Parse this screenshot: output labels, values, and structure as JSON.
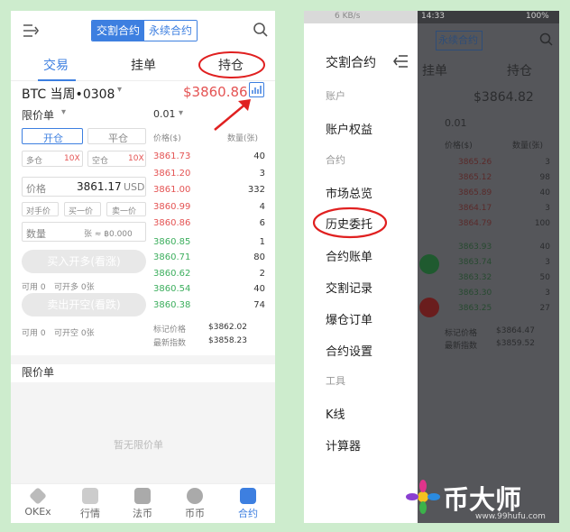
{
  "left": {
    "seg": [
      "交割合约",
      "永续合约"
    ],
    "tabs": [
      "交易",
      "挂单",
      "持仓"
    ],
    "symbol": "BTC 当周•0308",
    "price": "$3860.86",
    "order_type": "限价单",
    "qty_step": "0.01",
    "open_btn": "开仓",
    "close_btn": "平仓",
    "lev_long": "多仓",
    "lev_long_val": "10X",
    "lev_short": "空仓",
    "lev_short_val": "10X",
    "price_label": "价格",
    "price_value": "3861.17",
    "price_unit": "USD",
    "quick": [
      "对手价",
      "买一价",
      "卖一价"
    ],
    "qty_label": "数量",
    "qty_suffix": "张 ≈ ฿0.000",
    "buy_btn": "买入开多(看涨)",
    "avail1": "可用 0",
    "avail1b": "可开多 0张",
    "sell_btn": "卖出开空(看跌)",
    "avail2": "可用 0",
    "avail2b": "可开空 0张",
    "book_price_h": "价格($)",
    "book_qty_h": "数量(张)",
    "asks": [
      [
        "3861.73",
        "40"
      ],
      [
        "3861.20",
        "3"
      ],
      [
        "3861.00",
        "332"
      ],
      [
        "3860.99",
        "4"
      ],
      [
        "3860.86",
        "6"
      ]
    ],
    "bids": [
      [
        "3860.85",
        "1"
      ],
      [
        "3860.71",
        "80"
      ],
      [
        "3860.62",
        "2"
      ],
      [
        "3860.54",
        "40"
      ],
      [
        "3860.38",
        "74"
      ]
    ],
    "mark_label": "标记价格",
    "mark_value": "$3862.02",
    "index_label": "最新指数",
    "index_value": "$3858.23",
    "pending_title": "限价单",
    "empty": "暂无限价单",
    "nav": [
      "OKEx",
      "行情",
      "法币",
      "币币",
      "合约"
    ]
  },
  "right": {
    "status_time": "14:33",
    "status_speed": "6 KB/s",
    "status_batt": "100%",
    "bg_seg": "永续合约",
    "bg_tabs": [
      "挂单",
      "持仓"
    ],
    "bg_price": "$3864.82",
    "bg_qty_step": "0.01",
    "bg_book_h": [
      "价格($)",
      "数量(张)"
    ],
    "bg_asks": [
      [
        "3865.26",
        "3"
      ],
      [
        "3865.12",
        "98"
      ],
      [
        "3865.89",
        "40"
      ],
      [
        "3864.17",
        "3"
      ],
      [
        "3864.79",
        "100"
      ]
    ],
    "bg_bids": [
      [
        "3863.93",
        "40"
      ],
      [
        "3863.74",
        "3"
      ],
      [
        "3863.32",
        "50"
      ],
      [
        "3863.30",
        "3"
      ],
      [
        "3863.25",
        "27"
      ]
    ],
    "bg_mark_label": "标记价格",
    "bg_mark_value": "$3864.47",
    "bg_index_label": "最新指数",
    "bg_index_value": "$3859.52",
    "drawer_title": "交割合约",
    "drawer_items": [
      {
        "kind": "h",
        "label": "账户"
      },
      {
        "kind": "i",
        "label": "账户权益"
      },
      {
        "kind": "h",
        "label": "合约"
      },
      {
        "kind": "i",
        "label": "市场总览"
      },
      {
        "kind": "i",
        "label": "历史委托"
      },
      {
        "kind": "i",
        "label": "合约账单"
      },
      {
        "kind": "i",
        "label": "交割记录"
      },
      {
        "kind": "i",
        "label": "爆仓订单"
      },
      {
        "kind": "i",
        "label": "合约设置"
      },
      {
        "kind": "h",
        "label": "工具"
      },
      {
        "kind": "i",
        "label": "K线"
      },
      {
        "kind": "i",
        "label": "计算器"
      }
    ],
    "watermark": "币大师",
    "watermark_url": "www.99hufu.com"
  },
  "colors": {
    "accent": "#3d7fe0",
    "ask": "#e45353",
    "bid": "#3cae5d",
    "highlight": "#e02020"
  }
}
